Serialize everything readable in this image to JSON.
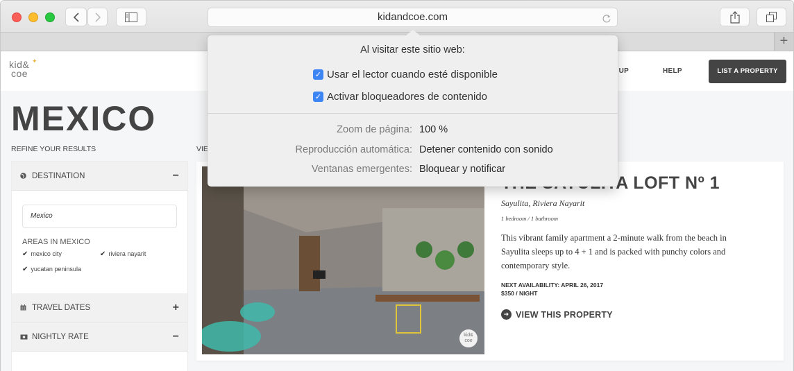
{
  "browser": {
    "url": "kidandcoe.com",
    "icons": {
      "close": "traffic-light-red",
      "minimize": "traffic-light-yellow",
      "zoom": "traffic-light-green",
      "back": "chevron-left-icon",
      "forward": "chevron-right-icon",
      "sidebar": "sidebar-icon",
      "reload": "reload-icon",
      "share": "share-icon",
      "tabs": "tabs-overview-icon",
      "new_tab": "+"
    }
  },
  "popover": {
    "title": "Al visitar este sitio web:",
    "checkboxes": [
      {
        "label": "Usar el lector cuando esté disponible",
        "checked": true
      },
      {
        "label": "Activar bloqueadores de contenido",
        "checked": true
      }
    ],
    "settings": [
      {
        "label": "Zoom de página:",
        "value": "100 %"
      },
      {
        "label": "Reproducción automática:",
        "value": "Detener contenido con sonido"
      },
      {
        "label": "Ventanas emergentes:",
        "value": "Bloquear y notificar"
      }
    ],
    "accent_color": "#3d85f5"
  },
  "site": {
    "logo_line1": "kid&",
    "logo_line2": "coe",
    "nav": {
      "signup": "N UP",
      "help": "HELP",
      "list_property": "LIST A PROPERTY"
    },
    "page_title": "MEXICO",
    "refine_label": "REFINE YOUR RESULTS",
    "view_label": "VIE",
    "filters": {
      "destination": {
        "label": "DESTINATION",
        "toggle": "−",
        "icon": "globe-icon"
      },
      "destination_value": "Mexico",
      "areas_title": "AREAS IN MEXICO",
      "areas": [
        {
          "label": "mexico city",
          "checked": true
        },
        {
          "label": "riviera nayarit",
          "checked": true
        },
        {
          "label": "yucatan peninsula",
          "checked": true
        }
      ],
      "travel_dates": {
        "label": "TRAVEL DATES",
        "toggle": "+",
        "icon": "calendar-icon"
      },
      "nightly_rate": {
        "label": "NIGHTLY RATE",
        "toggle": "−",
        "icon": "money-icon"
      }
    },
    "listing": {
      "title": "THE SAYULITA LOFT Nº 1",
      "location": "Sayulita, Riviera Nayarit",
      "rooms": "1 bedroom / 1 bathroom",
      "description": "This vibrant family apartment a 2-minute walk from the beach in Sayulita sleeps up to 4 + 1 and is packed with punchy colors and contemporary style.",
      "availability": "NEXT AVAILABILITY: APRIL 26, 2017",
      "price": "$350 / NIGHT",
      "cta": "VIEW THIS PROPERTY",
      "photo_badge_line1": "kid&",
      "photo_badge_line2": "coe"
    }
  }
}
